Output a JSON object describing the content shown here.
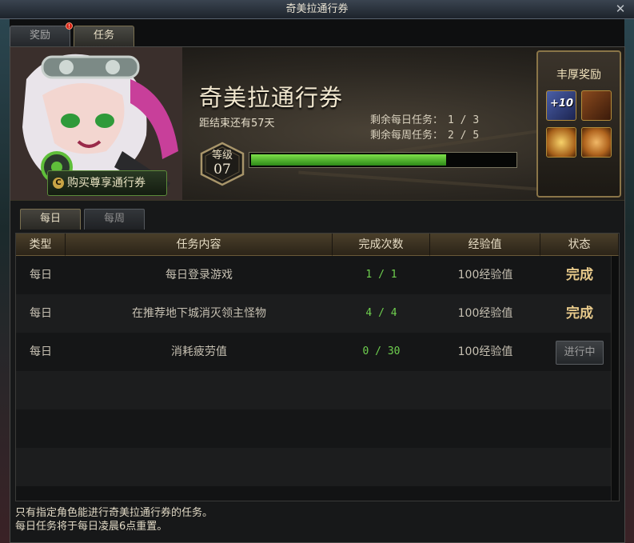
{
  "window": {
    "title": "奇美拉通行券"
  },
  "top_tabs": [
    {
      "label": "奖励",
      "alert": "!"
    },
    {
      "label": "任务"
    }
  ],
  "banner": {
    "title": "奇美拉通行券",
    "remaining_time": "距结束还有57天",
    "daily_label": "剩余每日任务：",
    "daily_value": "1 / 3",
    "weekly_label": "剩余每周任务：",
    "weekly_value": "2 / 5",
    "level_label": "等级",
    "level_value": "07",
    "xp_progress": 0.74,
    "buy_button": "购买尊享通行券",
    "coin_glyph": "C"
  },
  "rewards": {
    "title": "丰厚奖励",
    "icon1_text": "+10",
    "icons": [
      "enhancement-card-icon",
      "treasure-box-icon",
      "gold-lamp-icon",
      "gift-box-icon"
    ]
  },
  "mission_tabs": [
    {
      "label": "每日"
    },
    {
      "label": "每周"
    }
  ],
  "table": {
    "headers": [
      "类型",
      "任务内容",
      "完成次数",
      "经验值",
      "状态"
    ],
    "rows": [
      {
        "type": "每日",
        "content": "每日登录游戏",
        "count": "1 / 1",
        "exp": "100经验值",
        "status": "完成"
      },
      {
        "type": "每日",
        "content": "在推荐地下城消灭领主怪物",
        "count": "4 / 4",
        "exp": "100经验值",
        "status": "完成"
      },
      {
        "type": "每日",
        "content": "消耗疲劳值",
        "count": "0 / 30",
        "exp": "100经验值",
        "status": "进行中"
      }
    ]
  },
  "footer": {
    "line1": "只有指定角色能进行奇美拉通行券的任务。",
    "line2": "每日任务将于每日凌晨6点重置。"
  },
  "colors": {
    "accent_green": "#6fd04f",
    "gold": "#e7c98a",
    "frame_gold": "#8a7548"
  }
}
